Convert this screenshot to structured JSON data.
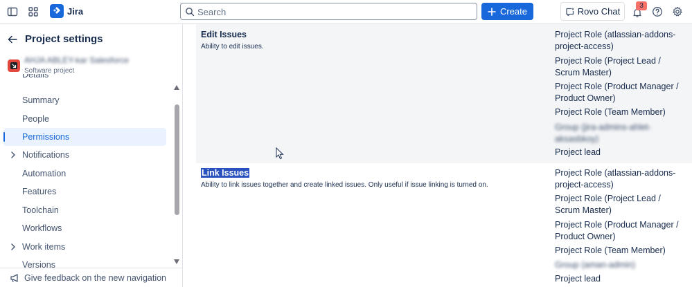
{
  "topbar": {
    "app_name": "Jira",
    "search_placeholder": "Search",
    "create_label": "Create",
    "rovo_label": "Rovo Chat",
    "notification_count": "3",
    "icons": [
      "sidebar-toggle-icon",
      "app-switcher-icon",
      "jira-logo-icon",
      "search-icon",
      "plus-icon",
      "rovo-icon",
      "bell-icon",
      "help-icon",
      "gear-icon"
    ]
  },
  "sidebar": {
    "title": "Project settings",
    "project": {
      "name": "AHJA ABLEY-kar Salesforce",
      "type": "Software project"
    },
    "items": [
      {
        "label": "Details",
        "expandable": false,
        "active": false
      },
      {
        "label": "Summary",
        "expandable": false,
        "active": false
      },
      {
        "label": "People",
        "expandable": false,
        "active": false
      },
      {
        "label": "Permissions",
        "expandable": false,
        "active": true
      },
      {
        "label": "Notifications",
        "expandable": true,
        "active": false
      },
      {
        "label": "Automation",
        "expandable": false,
        "active": false
      },
      {
        "label": "Features",
        "expandable": false,
        "active": false
      },
      {
        "label": "Toolchain",
        "expandable": false,
        "active": false
      },
      {
        "label": "Workflows",
        "expandable": false,
        "active": false
      },
      {
        "label": "Work items",
        "expandable": true,
        "active": false
      },
      {
        "label": "Versions",
        "expandable": false,
        "active": false
      }
    ],
    "feedback_label": "Give feedback on the new navigation"
  },
  "permissions": [
    {
      "name": "Edit Issues",
      "description": "Ability to edit issues.",
      "grantees": [
        "Project Role (atlassian-addons-project-access)",
        "Project Role (Project Lead / Scrum Master)",
        "Project Role (Product Manager / Product Owner)",
        "Project Role (Team Member)",
        "Group (jira-admins-ahlet-aksasbkoy)",
        "Project lead"
      ]
    },
    {
      "name": "Link Issues",
      "description": "Ability to link issues together and create linked issues. Only useful if issue linking is turned on.",
      "grantees": [
        "Project Role (atlassian-addons-project-access)",
        "Project Role (Project Lead / Scrum Master)",
        "Project Role (Product Manager / Product Owner)",
        "Project Role (Team Member)",
        "Group (aman-admin)",
        "Project lead"
      ]
    }
  ],
  "colors": {
    "primary": "#1868db",
    "row_shade": "#f4f5f7",
    "selection": "#2a52be",
    "badge": "#f87168"
  }
}
